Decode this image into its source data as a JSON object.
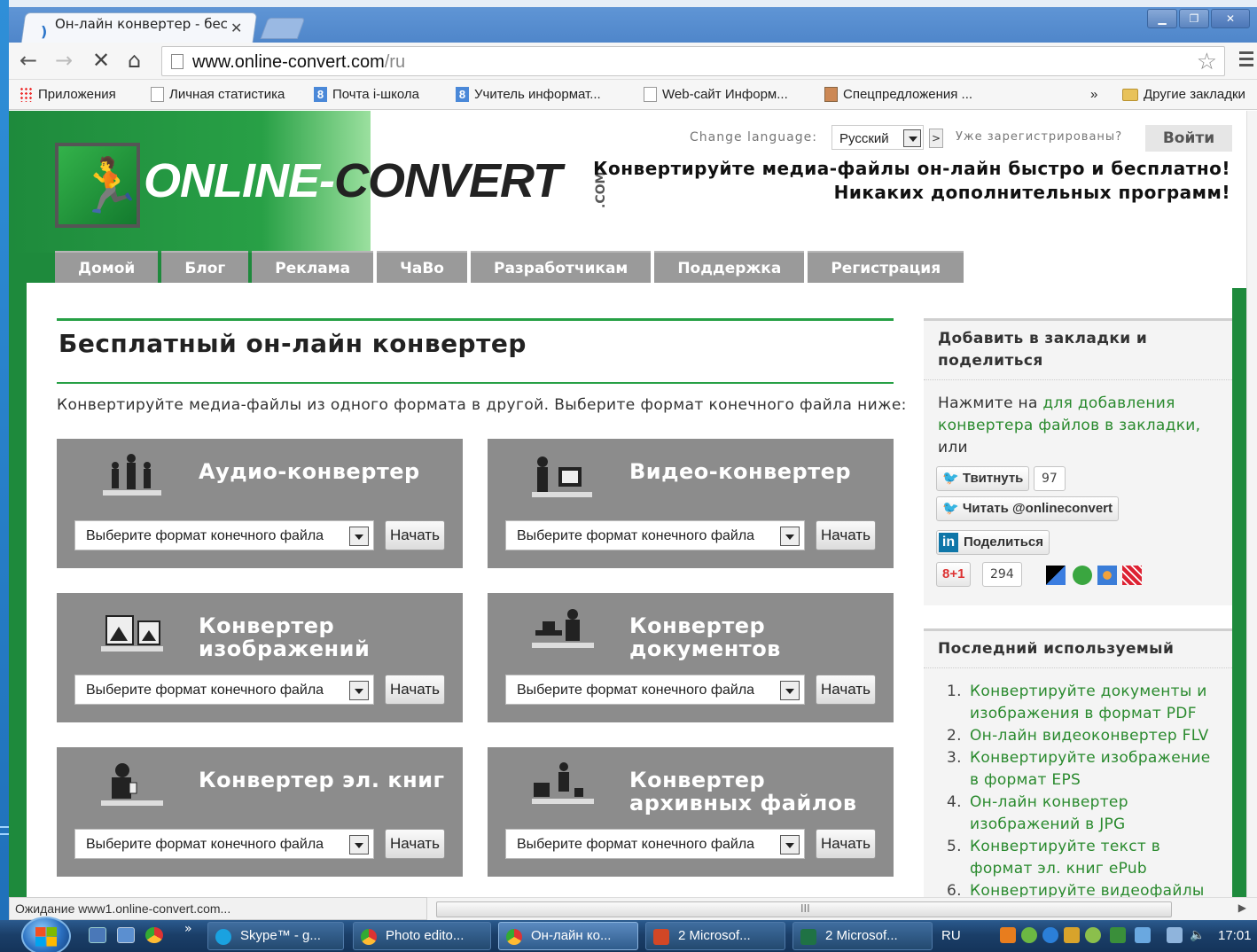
{
  "browser": {
    "tab_title": "Он-лайн конвертер - бес",
    "url_host": "www.online-convert.com",
    "url_path": "/ru",
    "bookmarks": [
      {
        "label": "Приложения",
        "icon": "apps-icon"
      },
      {
        "label": "Личная статистика",
        "icon": "page-icon"
      },
      {
        "label": "Почта i-школа",
        "icon": "blue-8-icon"
      },
      {
        "label": "Учитель информат...",
        "icon": "blue-8-icon"
      },
      {
        "label": "Web-сайт Информ...",
        "icon": "page-icon"
      },
      {
        "label": "Спецпредложения ...",
        "icon": "gift-icon"
      }
    ],
    "bookmarks_more": "»",
    "other_bookmarks": "Другие закладки",
    "status_text": "Ожидание www1.online-convert.com..."
  },
  "site": {
    "logo": {
      "online": "ONLINE",
      "dash": "-",
      "convert": "CONVERT",
      "com": ".COM"
    },
    "change_language_label": "Change language:",
    "language_value": "Русский",
    "language_go": ">",
    "registered_text": "Уже зарегистрированы?",
    "login_label": "Войти",
    "slogan_line1": "Конвертируйте медиа-файлы он-лайн быстро и бесплатно!",
    "slogan_line2": "Никаких дополнительных программ!",
    "nav": [
      "Домой",
      "Блог",
      "Реклама",
      "ЧаВо",
      "Разработчикам",
      "Поддержка",
      "Регистрация"
    ],
    "main_title": "Бесплатный он-лайн конвертер",
    "main_subtitle": "Конвертируйте медиа-файлы из одного формата в другой. Выберите формат конечного файла ниже:",
    "select_placeholder": "Выберите формат конечного файла",
    "start_label": "Начать",
    "converters": [
      {
        "title": "Аудио-конвертер",
        "icon": "audio-people-icon"
      },
      {
        "title": "Видео-конвертер",
        "icon": "video-camera-icon"
      },
      {
        "title": "Конвертер изображений",
        "icon": "image-frames-icon"
      },
      {
        "title": "Конвертер документов",
        "icon": "document-desk-icon"
      },
      {
        "title": "Конвертер эл. книг",
        "icon": "ebook-reader-icon"
      },
      {
        "title": "Конвертер архивных файлов",
        "icon": "archive-boxes-icon"
      }
    ],
    "sidebar": {
      "bookmark_title": "Добавить в закладки и поделиться",
      "bookmark_text_pre": "Нажмите на ",
      "bookmark_link": "для добавления конвертера файлов в закладки,",
      "bookmark_text_post": "или",
      "tweet_label": "Твитнуть",
      "tweet_count": "97",
      "follow_label": "Читать @onlineconvert",
      "linkedin_label": "Поделиться",
      "gplus_label": "+1",
      "gplus_count": "294",
      "recent_title": "Последний используемый",
      "recent": [
        {
          "num": "1.",
          "text": "Конвертируйте документы и изображения в формат PDF"
        },
        {
          "num": "2.",
          "text": "Он-лайн видеоконвертер FLV"
        },
        {
          "num": "3.",
          "text": "Конвертируйте изображение в формат EPS"
        },
        {
          "num": "4.",
          "text": "Он-лайн конвертер изображений в JPG"
        },
        {
          "num": "5.",
          "text": "Конвертируйте текст в формат эл. книг ePub"
        },
        {
          "num": "6.",
          "text": "Конвертируйте видеофайлы в"
        }
      ]
    }
  },
  "taskbar": {
    "items": [
      {
        "label": "Skype™ - g...",
        "icon": "skype-icon",
        "active": false
      },
      {
        "label": "Photo edito...",
        "icon": "chrome-icon",
        "active": false
      },
      {
        "label": "Он-лайн ко...",
        "icon": "chrome-icon",
        "active": true
      },
      {
        "label": "2 Microsof...",
        "icon": "powerpoint-icon",
        "active": false
      },
      {
        "label": "2 Microsof...",
        "icon": "excel-icon",
        "active": false
      }
    ],
    "more": "»",
    "lang": "RU",
    "clock": "17:01"
  },
  "colors": {
    "site_green": "#1e8a3c",
    "card_gray": "#8c8c8c",
    "link_green": "#2a8a2e",
    "nav_gray": "#9a9a9a"
  }
}
